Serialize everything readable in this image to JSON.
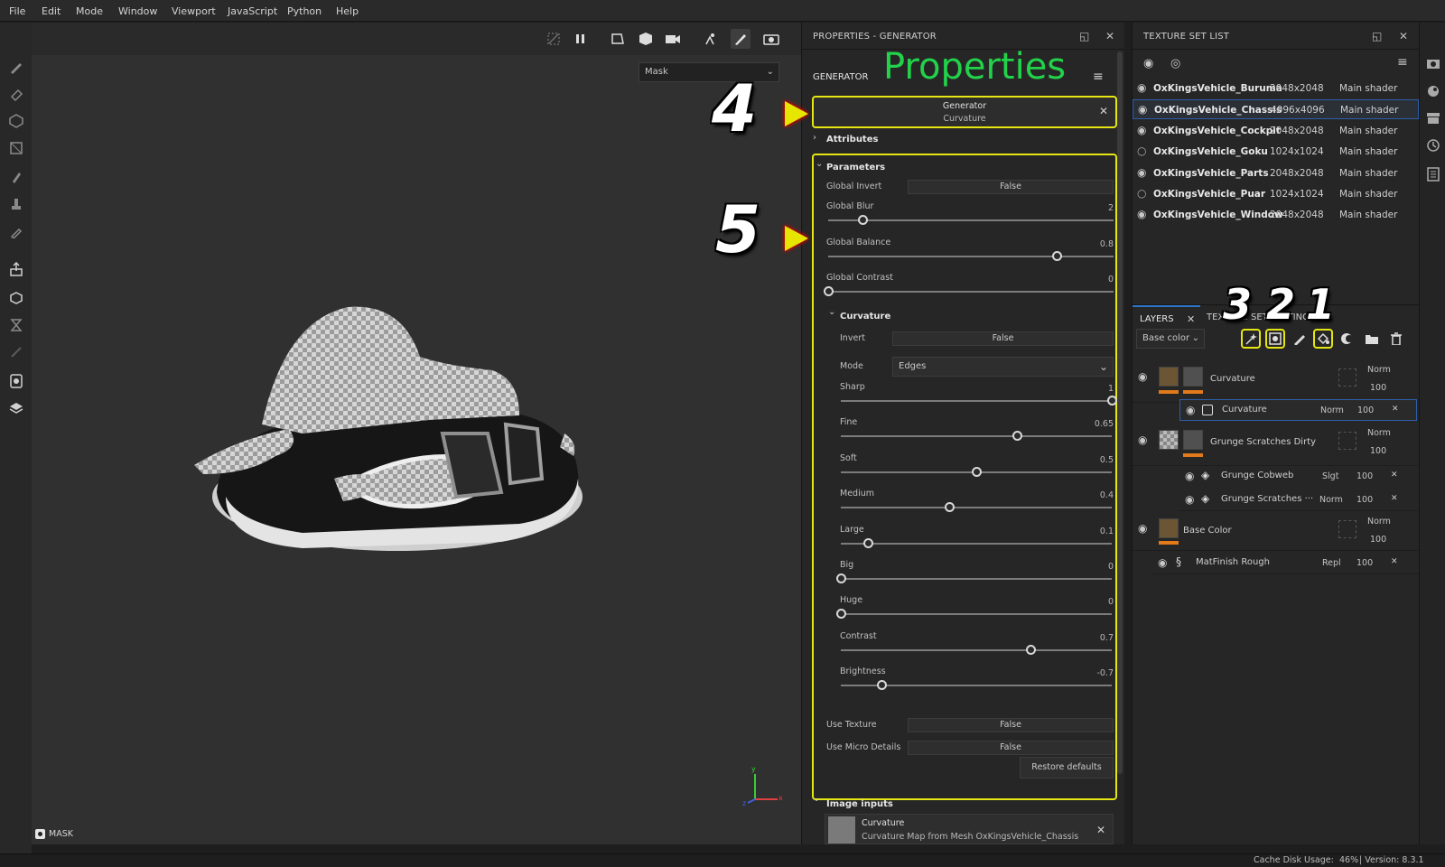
{
  "menu": [
    "File",
    "Edit",
    "Mode",
    "Window",
    "Viewport",
    "JavaScript",
    "Python",
    "Help"
  ],
  "viewport": {
    "channel_select": "Mask",
    "mode_badge": "MASK",
    "axis_labels": {
      "x": "x",
      "y": "y",
      "z": "z"
    }
  },
  "properties": {
    "window_title": "PROPERTIES - GENERATOR",
    "header": "GENERATOR",
    "overlay_title": "Properties",
    "generator_card": {
      "title": "Generator",
      "subtitle": "Curvature"
    },
    "attributes_label": "Attributes",
    "parameters_label": "Parameters",
    "global_invert": {
      "label": "Global Invert",
      "value": "False"
    },
    "global_sliders": [
      {
        "label": "Global Blur",
        "value": "2",
        "fraction": 0.12
      },
      {
        "label": "Global Balance",
        "value": "0.8",
        "fraction": 0.8
      },
      {
        "label": "Global Contrast",
        "value": "0",
        "fraction": 0.0
      }
    ],
    "curvature_label": "Curvature",
    "invert": {
      "label": "Invert",
      "value": "False"
    },
    "mode": {
      "label": "Mode",
      "value": "Edges"
    },
    "curv_sliders": [
      {
        "label": "Sharp",
        "value": "1",
        "fraction": 1.0
      },
      {
        "label": "Fine",
        "value": "0.65",
        "fraction": 0.65
      },
      {
        "label": "Soft",
        "value": "0.5",
        "fraction": 0.5
      },
      {
        "label": "Medium",
        "value": "0.4",
        "fraction": 0.4
      },
      {
        "label": "Large",
        "value": "0.1",
        "fraction": 0.1
      },
      {
        "label": "Big",
        "value": "0",
        "fraction": 0.0
      },
      {
        "label": "Huge",
        "value": "0",
        "fraction": 0.0
      },
      {
        "label": "Contrast",
        "value": "0.7",
        "fraction": 0.7
      },
      {
        "label": "Brightness",
        "value": "-0.7",
        "fraction": 0.15
      }
    ],
    "use_texture": {
      "label": "Use Texture",
      "value": "False"
    },
    "use_micro": {
      "label": "Use Micro Details",
      "value": "False"
    },
    "restore_label": "Restore defaults",
    "image_inputs_label": "Image inputs",
    "image_input": {
      "title": "Curvature",
      "subtitle": "Curvature Map from Mesh OxKingsVehicle_Chassis"
    }
  },
  "texture_set_list": {
    "title": "TEXTURE SET LIST",
    "rows": [
      {
        "name": "OxKingsVehicle_Buruma",
        "res": "2048x2048",
        "shader": "Main shader",
        "selected": false,
        "visible": true
      },
      {
        "name": "OxKingsVehicle_Chassis",
        "res": "4096x4096",
        "shader": "Main shader",
        "selected": true,
        "visible": true
      },
      {
        "name": "OxKingsVehicle_Cockpit",
        "res": "2048x2048",
        "shader": "Main shader",
        "selected": false,
        "visible": true
      },
      {
        "name": "OxKingsVehicle_Goku",
        "res": "1024x1024",
        "shader": "Main shader",
        "selected": false,
        "visible": false
      },
      {
        "name": "OxKingsVehicle_Parts",
        "res": "2048x2048",
        "shader": "Main shader",
        "selected": false,
        "visible": true
      },
      {
        "name": "OxKingsVehicle_Puar",
        "res": "1024x1024",
        "shader": "Main shader",
        "selected": false,
        "visible": false
      },
      {
        "name": "OxKingsVehicle_Window",
        "res": "2048x2048",
        "shader": "Main shader",
        "selected": false,
        "visible": true
      }
    ]
  },
  "layers": {
    "tab_layers": "LAYERS",
    "tab_texset_settings": "TEXTURE SET SETTINGS",
    "channel": "Base color",
    "items": [
      {
        "name": "Curvature",
        "blend": "Norm",
        "opacity": "100",
        "level": 0
      },
      {
        "name": "Curvature",
        "blend": "Norm",
        "opacity": "100",
        "level": 1
      },
      {
        "name": "Grunge Scratches Dirty",
        "blend": "Norm",
        "opacity": "100",
        "level": 0
      },
      {
        "name": "Grunge Cobweb",
        "blend": "Slgt",
        "opacity": "100",
        "level": 1
      },
      {
        "name": "Grunge Scratches ···",
        "blend": "Norm",
        "opacity": "100",
        "level": 1
      },
      {
        "name": "Base Color",
        "blend": "Norm",
        "opacity": "100",
        "level": 0
      },
      {
        "name": "MatFinish Rough",
        "blend": "Repl",
        "opacity": "100",
        "level": 1
      }
    ]
  },
  "annotations": {
    "n1": "1",
    "n2": "2",
    "n3": "3",
    "n4": "4",
    "n5": "5"
  },
  "status": {
    "cache_label": "Cache Disk Usage:",
    "cache_value": "46%",
    "version": "| Version: 8.3.1"
  },
  "colors": {
    "accent": "#e6e614",
    "arrow": "#e6e600",
    "select": "#2e5fa8",
    "orange": "#e07a1a",
    "green": "#22d24a"
  }
}
